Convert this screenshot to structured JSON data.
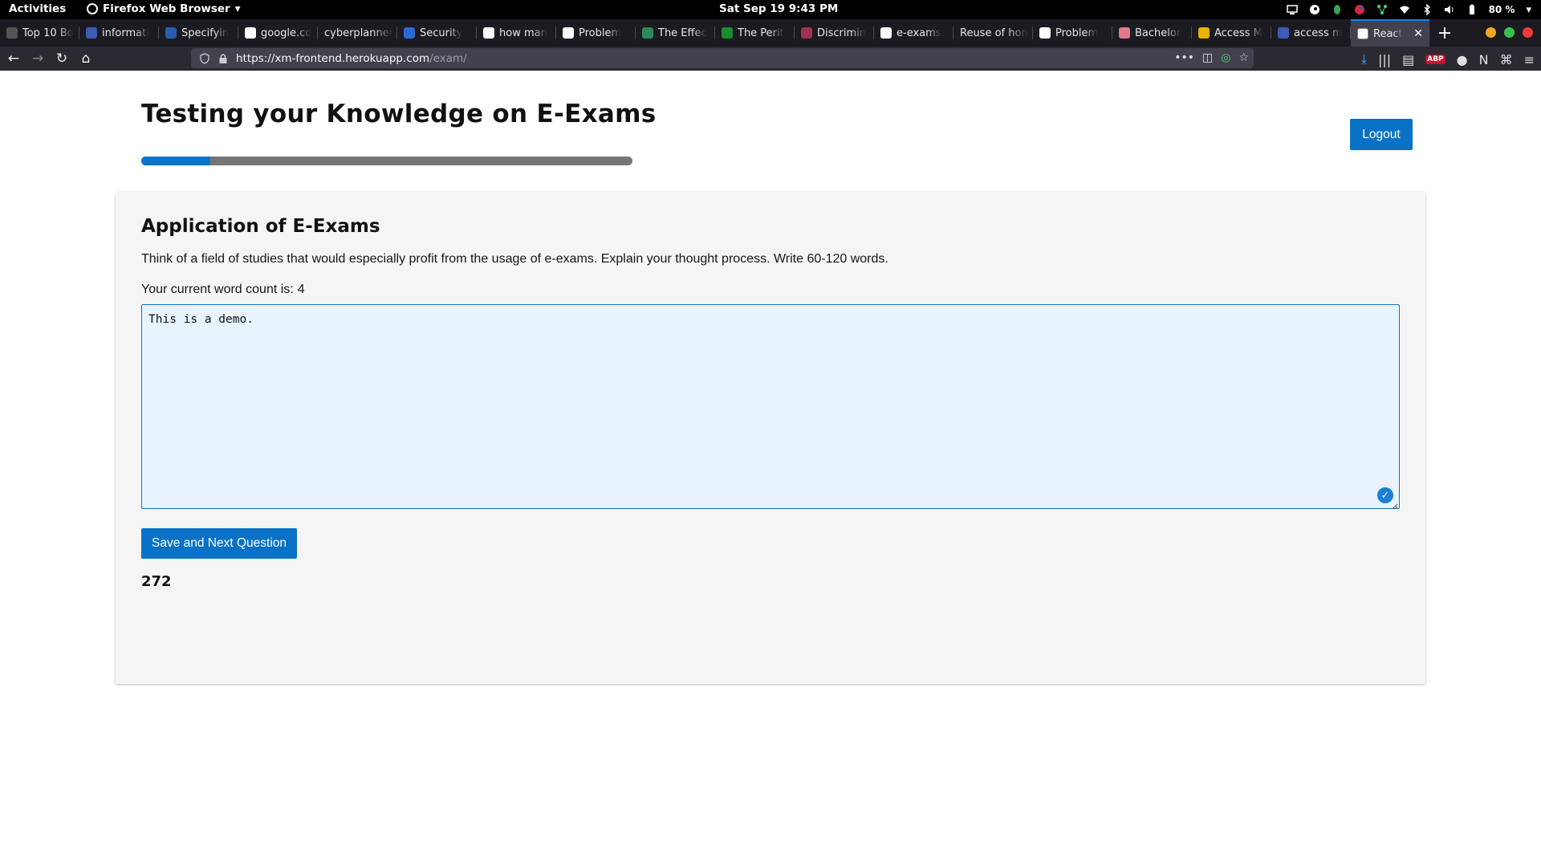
{
  "topbar": {
    "activities": "Activities",
    "app_menu": "Firefox Web Browser",
    "clock": "Sat Sep 19   9:43 PM",
    "battery": "80 %"
  },
  "tabs": [
    {
      "label": "Top 10 Bo",
      "fav_color": "#555"
    },
    {
      "label": "informati",
      "fav_color": "#3b5bb5"
    },
    {
      "label": "Specifyin",
      "fav_color": "#2a5db0"
    },
    {
      "label": "google.co",
      "fav_color": "#ffffff"
    },
    {
      "label": "cyberplanner",
      "fav_color": ""
    },
    {
      "label": "Security",
      "fav_color": "#2c6ad6"
    },
    {
      "label": "how man",
      "fav_color": "#ffffff"
    },
    {
      "label": "Problem",
      "fav_color": "#ffffff"
    },
    {
      "label": "The Effec",
      "fav_color": "#2a8a58"
    },
    {
      "label": "The Perit",
      "fav_color": "#1a8d2e"
    },
    {
      "label": "Discrimin",
      "fav_color": "#a0324f"
    },
    {
      "label": "e-exams",
      "fav_color": "#ffffff"
    },
    {
      "label": "Reuse of hon",
      "fav_color": ""
    },
    {
      "label": "Problem",
      "fav_color": "#ffffff"
    },
    {
      "label": "Bachelor",
      "fav_color": "#e07a8a"
    },
    {
      "label": "Access M",
      "fav_color": "#e8b400"
    },
    {
      "label": "access m",
      "fav_color": "#3b5bb5"
    }
  ],
  "active_tab": {
    "label": "React"
  },
  "nav": {
    "url_host": "https://xm-frontend.herokuapp.com",
    "url_path": "/exam/"
  },
  "page": {
    "title": "Testing your Knowledge on E-Exams",
    "logout_label": "Logout",
    "progress": 0.14
  },
  "question": {
    "title": "Application of E-Exams",
    "text": "Think of a field of studies that would especially profit from the usage of e-exams. Explain your thought process. Write 60-120 words.",
    "word_count_label": "Your current word count is:",
    "word_count": "4",
    "answer": "This is a demo.",
    "save_label": "Save and Next Question",
    "timer": "272"
  },
  "colors": {
    "accent": "#0a72c6",
    "card_bg": "#f5f5f5",
    "textarea_bg": "#e8f3fd"
  }
}
